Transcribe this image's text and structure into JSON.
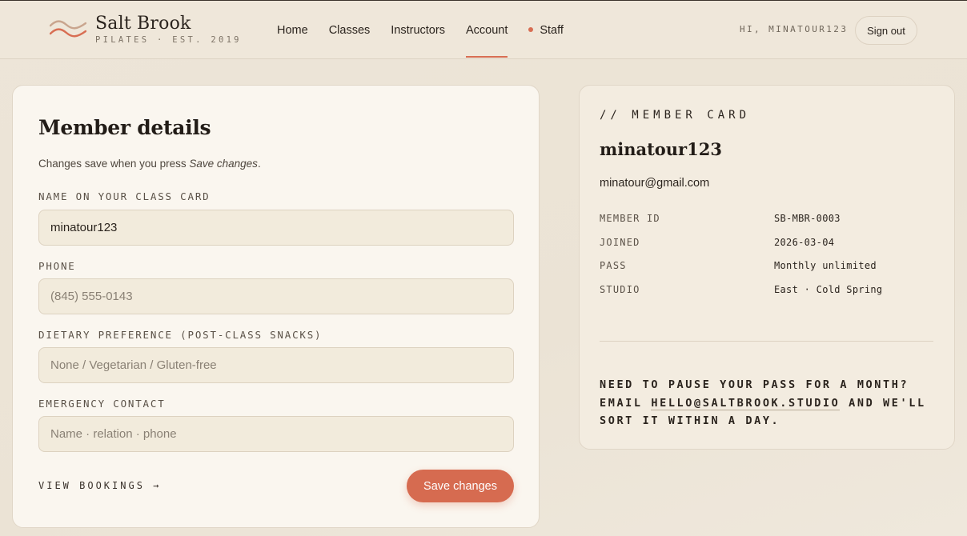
{
  "brand": {
    "name": "Salt Brook",
    "subtitle": "PILATES · EST. 2019",
    "wave_colors": [
      "#c9a58e",
      "#d86e53"
    ]
  },
  "nav": {
    "items": [
      {
        "label": "Home"
      },
      {
        "label": "Classes"
      },
      {
        "label": "Instructors"
      },
      {
        "label": "Account",
        "active": true
      },
      {
        "label": "Staff"
      }
    ]
  },
  "header": {
    "greeting": "HI, MINATOUR123",
    "signout_label": "Sign out"
  },
  "details": {
    "title": "Member details",
    "note_prefix": "Changes save when you press ",
    "note_emph": "Save changes",
    "note_suffix": ".",
    "fields": [
      {
        "label": "NAME ON YOUR CLASS CARD",
        "value": "minatour123",
        "placeholder": ""
      },
      {
        "label": "PHONE",
        "value": "",
        "placeholder": "(845) 555-0143"
      },
      {
        "label": "DIETARY PREFERENCE (POST-CLASS SNACKS)",
        "value": "",
        "placeholder": "None / Vegetarian / Gluten-free"
      },
      {
        "label": "EMERGENCY CONTACT",
        "value": "",
        "placeholder": "Name · relation · phone"
      }
    ],
    "view_bookings": "VIEW BOOKINGS →",
    "save_label": "Save changes"
  },
  "member_card": {
    "kicker": "// MEMBER CARD",
    "name": "minatour123",
    "email": "minatour@gmail.com",
    "rows": [
      {
        "key": "MEMBER ID",
        "value": "SB-MBR-0003"
      },
      {
        "key": "JOINED",
        "value": "2026-03-04"
      },
      {
        "key": "PASS",
        "value": "Monthly unlimited"
      },
      {
        "key": "STUDIO",
        "value": "East · Cold Spring"
      }
    ],
    "pause_prefix": "NEED TO PAUSE YOUR PASS FOR A MONTH? EMAIL ",
    "pause_link": "HELLO@SALTBROOK.STUDIO",
    "pause_suffix": " AND WE'LL SORT IT WITHIN A DAY."
  },
  "colors": {
    "accent": "#d66b50",
    "background": "#ede5d8",
    "card": "#faf6ef"
  }
}
